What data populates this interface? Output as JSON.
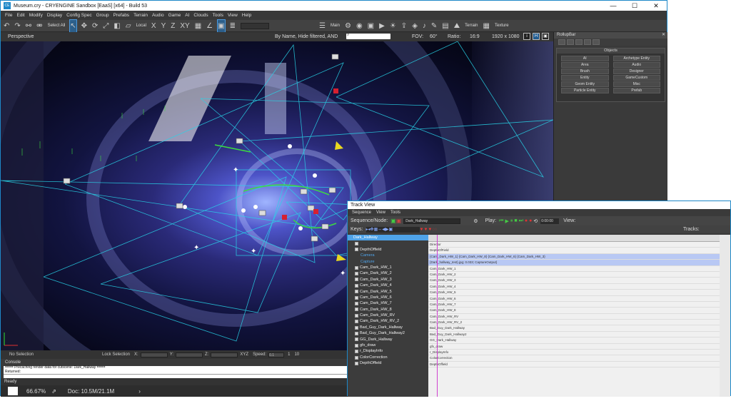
{
  "title": "Museum.cry - CRYENGINE Sandbox [EaaS] [x64] - Build 53",
  "menu": [
    "File",
    "Edit",
    "Modify",
    "Display",
    "Config Spec",
    "Group",
    "Prefabs",
    "Terrain",
    "Audio",
    "Game",
    "AI",
    "Clouds",
    "Tools",
    "View",
    "Help"
  ],
  "toolbar": {
    "select_all": "Select All",
    "coord": "Local",
    "axes": [
      "X",
      "Y",
      "Z",
      "XY"
    ],
    "main": "Main",
    "terrain": "Terrain",
    "texture": "Texture"
  },
  "viewport": {
    "mode": "Perspective",
    "filter": "By Name, Hide filtered, AND",
    "fov_label": "FOV:",
    "fov": "60°",
    "ratio_label": "Ratio:",
    "ratio": "16:9",
    "resolution": "1920 x 1080"
  },
  "status": {
    "selection": "No Selection",
    "lock": "Lock Selection",
    "x": "X:",
    "y": "Y:",
    "z": "Z:",
    "xyz": "XYZ",
    "speed_label": "Speed:",
    "speed": "0.1",
    "step1": "1",
    "step10": "10"
  },
  "console": {
    "title": "Console",
    "lines": [
      "==== Precaching render data for cutscene: Dark_Hallway ====",
      "Returned:"
    ]
  },
  "ready": "Ready",
  "bottom": {
    "zoom": "66.67%",
    "doc": "Doc: 10.5M/21.1M"
  },
  "rollup": {
    "title": "RollupBar",
    "objects_header": "Objects",
    "buttons": [
      "AI",
      "Archetype Entity",
      "Area",
      "Audio",
      "Brush",
      "Designer",
      "Entity",
      "GameCustom",
      "Geom Entity",
      "Misc",
      "Particle Entity",
      "Prefab"
    ]
  },
  "track": {
    "title": "Track View",
    "menu": [
      "Sequence",
      "View",
      "Tools"
    ],
    "seq_label": "Sequence/Node:",
    "sequence": "Dark_Hallway",
    "play_label": "Play:",
    "time": "0:00:00",
    "view_label": "View:",
    "keys_label": "Keys:",
    "tracks_label": "Tracks:",
    "nodes": [
      "Dark_Hallway",
      "",
      "DepthOffield",
      "Camera",
      "Capture",
      "Cam_Dark_HW_1",
      "Cam_Dark_HW_2",
      "Cam_Dark_HW_3",
      "Cam_Dark_HW_4",
      "Cam_Dark_HW_5",
      "Cam_Dark_HW_6",
      "Cam_Dark_HW_7",
      "Cam_Dark_HW_8",
      "Cam_Dark_HW_RV",
      "Cam_Dark_HW_RV_2",
      "Bad_Guy_Dark_Hallway",
      "Bad_Guy_Dark_Hallway2",
      "GG_Dark_Hallway",
      "gfx_draw",
      "r_DisplayInfo",
      "ColorCorrection",
      "DepthOffield"
    ],
    "keyrows": [
      "Director",
      "DepthOfField",
      "{Cam_Dark_HW_1}   {Cam_Dark_HW_8}   {Cam_Dark_HW_6}   {Cam_Dark_HW_3}",
      "{Dark_hallway_test}.jpg; 0.033; CaptureOutput}",
      "Cam_Dark_HW_1",
      "Cam_Dark_HW_2",
      "Cam_Dark_HW_3",
      "Cam_Dark_HW_4",
      "Cam_Dark_HW_5",
      "Cam_Dark_HW_6",
      "Cam_Dark_HW_7",
      "Cam_Dark_HW_8",
      "Cam_Dark_HW_RV",
      "Cam_Dark_HW_RV_2",
      "Bad_Guy_Dark_Hallway",
      "Bad_Guy_Dark_Hallway2",
      "GG_Dark_Hallway",
      "gfx_draw",
      "r_DisplayInfo",
      "ColorCorrection",
      "DepthOffield"
    ]
  }
}
